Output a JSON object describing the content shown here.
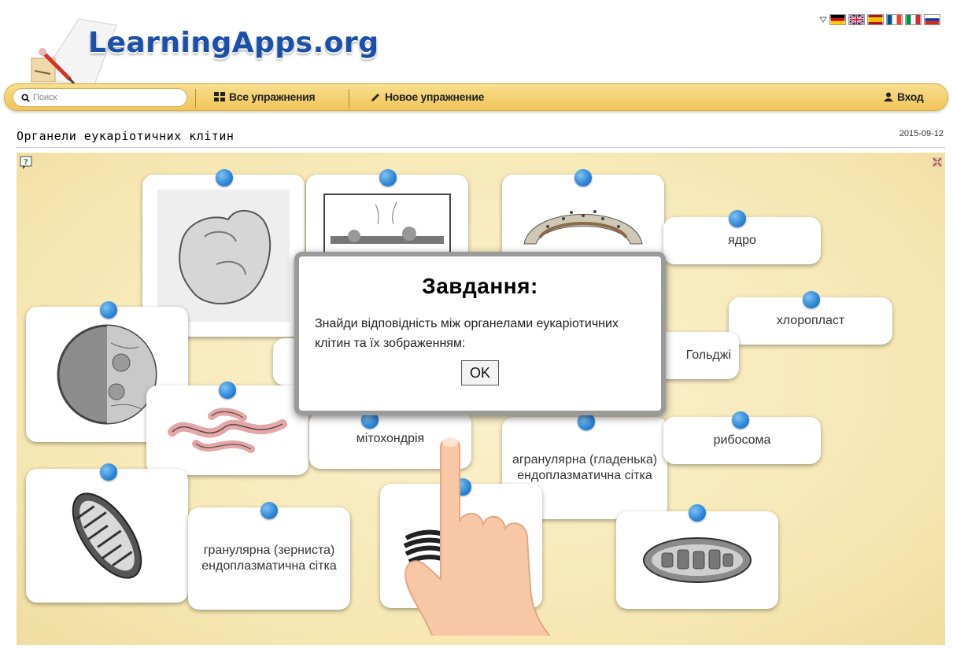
{
  "header": {
    "logo_text": "LearningApps.org",
    "languages": [
      {
        "name": "German",
        "colors": [
          "#000000",
          "#dd0000",
          "#ffce00"
        ]
      },
      {
        "name": "English",
        "colors": [
          "#012169",
          "#ffffff",
          "#c8102e"
        ]
      },
      {
        "name": "Spanish",
        "colors": [
          "#aa151b",
          "#f1bf00",
          "#aa151b"
        ]
      },
      {
        "name": "French",
        "colors": [
          "#0055a4",
          "#ffffff",
          "#ef4135"
        ]
      },
      {
        "name": "Italian",
        "colors": [
          "#009246",
          "#ffffff",
          "#ce2b37"
        ]
      },
      {
        "name": "Russian",
        "colors": [
          "#ffffff",
          "#0039a6",
          "#d52b1e"
        ]
      }
    ]
  },
  "navbar": {
    "search_placeholder": "Поиск",
    "all_exercises": "Все упражнения",
    "new_exercise": "Новое упражнение",
    "login": "Вход"
  },
  "page": {
    "title": "Органели еукаріотичних клітин",
    "date": "2015-09-12"
  },
  "cards": {
    "yadro": "ядро",
    "chloroplast": "хлоропласт",
    "golgi": "Гольджі",
    "mitochondria": "мітохондрія",
    "ribosome": "рибосома",
    "agranular": "агранулярна (гладенька) ендоплазматична сітка",
    "granular": "гранулярна (зерниста) ендоплазматична сітка"
  },
  "dialog": {
    "title": "Завдання:",
    "text": "Знайди відповідність між органелами еукаріотичних клітин та їх зображенням:",
    "ok": "OK"
  },
  "colors": {
    "accent_blue": "#2a84d6",
    "navbar": "#f2c55a",
    "stage": "#f6e7b3",
    "logo": "#1c4fa8"
  }
}
